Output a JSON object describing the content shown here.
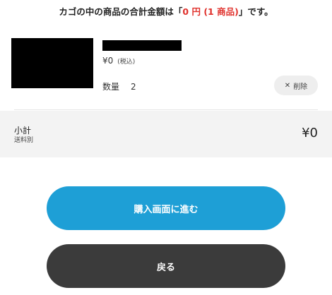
{
  "summary": {
    "prefix": "カゴの中の商品の合計金額は「",
    "highlight": "0 円 (1 商品)",
    "suffix": "」です。"
  },
  "item": {
    "price": "¥0",
    "tax_note": "(税込)",
    "quantity_label": "数量",
    "quantity_value": "2",
    "delete_icon": "close-icon",
    "delete_label": "削除"
  },
  "subtotal": {
    "label": "小計",
    "note": "送料別",
    "amount": "¥0"
  },
  "buttons": {
    "checkout_label": "購入画面に進む",
    "back_label": "戻る"
  },
  "colors": {
    "highlight": "#e0312c",
    "primary_button": "#1e9fd6",
    "back_button": "#3b3b3b"
  }
}
